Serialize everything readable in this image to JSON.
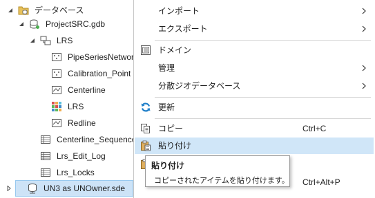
{
  "tree": {
    "items": [
      {
        "label": "データベース",
        "icon": "folder-database-icon"
      },
      {
        "label": "ProjectSRC.gdb",
        "icon": "geodatabase-icon"
      },
      {
        "label": "LRS",
        "icon": "feature-dataset-icon"
      },
      {
        "label": "PipeSeriesNetwork",
        "icon": "feature-class-icon"
      },
      {
        "label": "Calibration_Point",
        "icon": "feature-class-icon"
      },
      {
        "label": "Centerline",
        "icon": "feature-class-icon"
      },
      {
        "label": "LRS",
        "icon": "lrs-icon"
      },
      {
        "label": "Redline",
        "icon": "feature-class-icon"
      },
      {
        "label": "Centerline_Sequence",
        "icon": "table-icon"
      },
      {
        "label": "Lrs_Edit_Log",
        "icon": "table-icon"
      },
      {
        "label": "Lrs_Locks",
        "icon": "table-icon"
      },
      {
        "label": "UN3 as UNOwner.sde",
        "icon": "database-connection-icon"
      }
    ]
  },
  "menu": {
    "import": {
      "label": "インポート"
    },
    "export": {
      "label": "エクスポート"
    },
    "domain": {
      "label": "ドメイン"
    },
    "manage": {
      "label": "管理"
    },
    "distributed": {
      "label": "分散ジオデータベース"
    },
    "refresh": {
      "label": "更新"
    },
    "copy": {
      "label": "コピー",
      "shortcut": "Ctrl+C"
    },
    "paste": {
      "label": "貼り付け"
    },
    "paste_special": {
      "label": "",
      "shortcut": "Ctrl+Alt+P"
    }
  },
  "tooltip": {
    "title": "貼り付け",
    "description": "コピーされたアイテムを貼り付けます。"
  },
  "colors": {
    "selection": "#cde3f7",
    "menu_hover": "#d0e6f8",
    "refresh_blue": "#1f7fc9"
  }
}
